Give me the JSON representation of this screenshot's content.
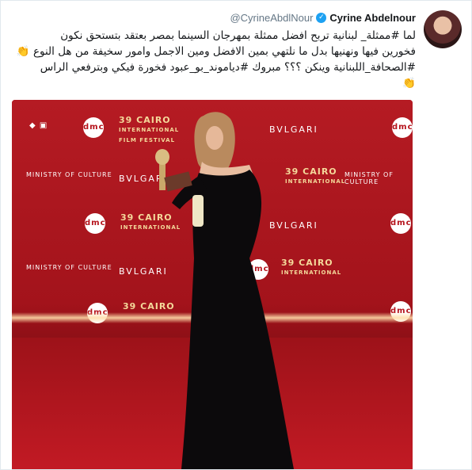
{
  "tweet": {
    "display_name": "Cyrine Abdelnour",
    "handle": "@CyrineAbdlNour",
    "line1": "لما #ممثلة_ لبنانية تربح افضل ممثلة بمهرجان السينما بمصر بعتقد بتستحق نكون",
    "line2": "فخورين فيها ونهنيها بدل ما نلتهي بمين الافضل ومين الاجمل وامور سخيفة من هل النوع",
    "line3": "#الصحافة_اللبنانية وينكن ؟؟؟ مبروك #دياموند_بو_عبود فخورة فيكي وبترفعي الراس"
  },
  "photo": {
    "festival_text": [
      "39",
      "CAIRO",
      "INTERNATIONAL",
      "FILM FESTIVAL"
    ],
    "dmc_label": "dmc",
    "bvlgari_label": "BVLGARI",
    "ministry_label": "MINISTRY OF CULTURE"
  },
  "icons": {
    "verified": "verified-badge-icon",
    "clap": "clapping-hands-icon"
  },
  "colors": {
    "link": "#1b95e0",
    "verified": "#1da1f2",
    "wall": "#b51b23"
  }
}
